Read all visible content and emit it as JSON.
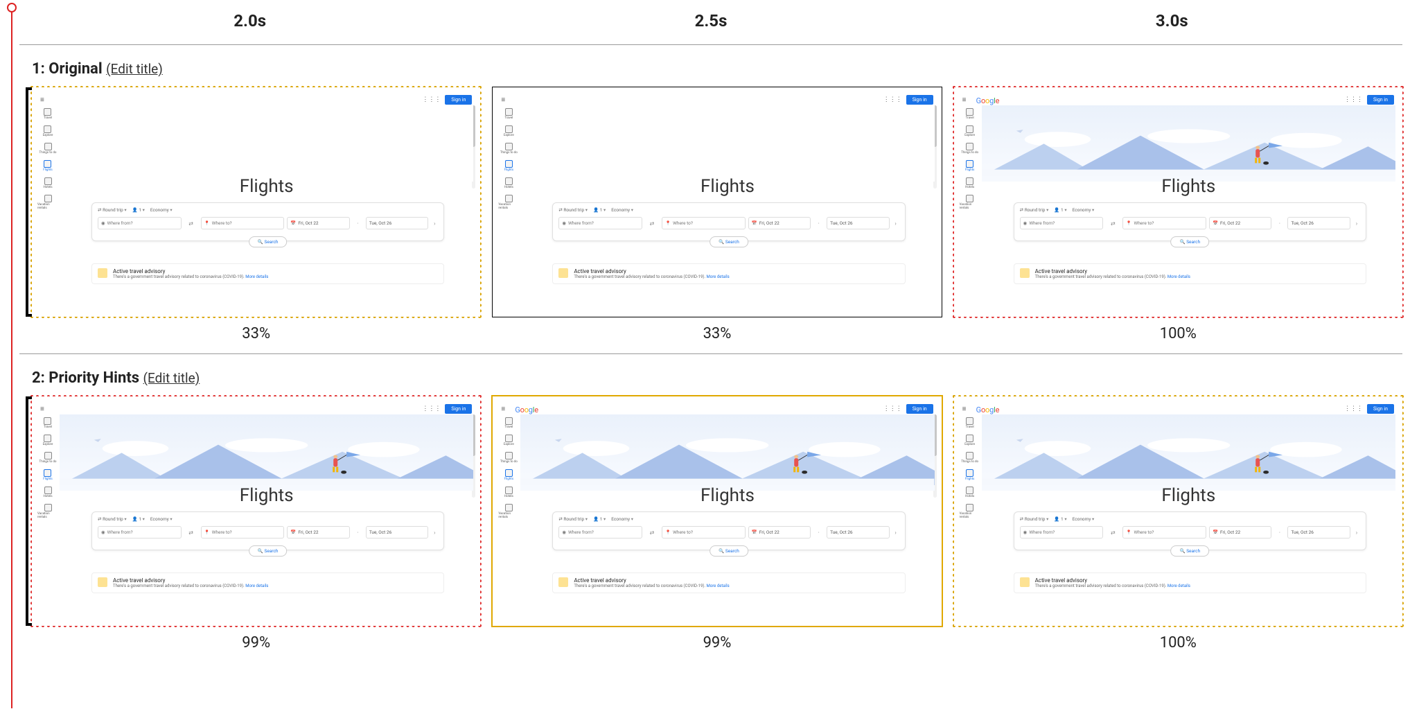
{
  "time_labels": [
    "2.0s",
    "2.5s",
    "3.0s"
  ],
  "edit_title_label": "(Edit title)",
  "rows": [
    {
      "title": "1: Original",
      "frames": [
        {
          "pct": "33%",
          "border": "b-dot-orange",
          "hero": false,
          "logo": false,
          "scrollbar": true
        },
        {
          "pct": "33%",
          "border": "b-solid-black",
          "hero": false,
          "logo": false,
          "scrollbar": true
        },
        {
          "pct": "100%",
          "border": "b-dot-red",
          "hero": true,
          "logo": true,
          "scrollbar": false
        }
      ]
    },
    {
      "title": "2: Priority Hints",
      "frames": [
        {
          "pct": "99%",
          "border": "b-dot-red",
          "hero": true,
          "logo": false,
          "scrollbar": true
        },
        {
          "pct": "99%",
          "border": "b-solid-orange",
          "hero": true,
          "logo": true,
          "scrollbar": true
        },
        {
          "pct": "100%",
          "border": "b-dot-orange",
          "hero": true,
          "logo": true,
          "scrollbar": false
        }
      ]
    }
  ],
  "flights": {
    "sign_in": "Sign in",
    "logo_chars": [
      "G",
      "o",
      "o",
      "g",
      "l",
      "e"
    ],
    "title": "Flights",
    "side_items": [
      {
        "label": "Travel"
      },
      {
        "label": "Explore"
      },
      {
        "label": "Things to do"
      },
      {
        "label": "Flights",
        "active": true
      },
      {
        "label": "Hotels"
      },
      {
        "label": "Vacation rentals"
      }
    ],
    "chips": {
      "trip": "Round trip",
      "pax": "1",
      "class": "Economy"
    },
    "from_placeholder": "Where from?",
    "to_placeholder": "Where to?",
    "date1": "Fri, Oct 22",
    "date2": "Tue, Oct 26",
    "search_label": "Search",
    "advisory_title": "Active travel advisory",
    "advisory_body": "There's a government travel advisory related to coronavirus (COVID-19).",
    "advisory_more": "More details"
  }
}
